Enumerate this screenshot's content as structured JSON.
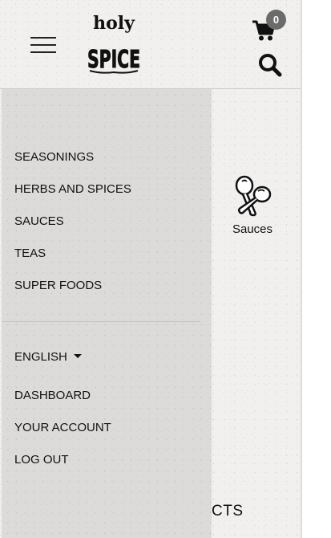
{
  "header": {
    "menu_icon": "hamburger-menu-icon",
    "logo_alt": "holy SPICE",
    "logo_top": "holy",
    "logo_bottom": "SPICE",
    "cart_icon": "shopping-cart-icon",
    "cart_count": "0",
    "search_icon": "magnifier-search-icon"
  },
  "drawer": {
    "categories": [
      "SEASONINGS",
      "HERBS AND SPICES",
      "SAUCES",
      "TEAS",
      "SUPER FOODS"
    ],
    "language": "ENGLISH",
    "account_links": [
      "DASHBOARD",
      "YOUR ACCOUNT",
      "LOG OUT"
    ]
  },
  "main": {
    "category_tile": {
      "label": "Sauces",
      "icon": "spoons-icon"
    },
    "partial_heading": "CTS"
  },
  "colors": {
    "page_bg": "#f1f0ee",
    "drawer_bg": "#dcdbd9",
    "badge_bg": "#6b6b6b",
    "text": "#111111"
  }
}
